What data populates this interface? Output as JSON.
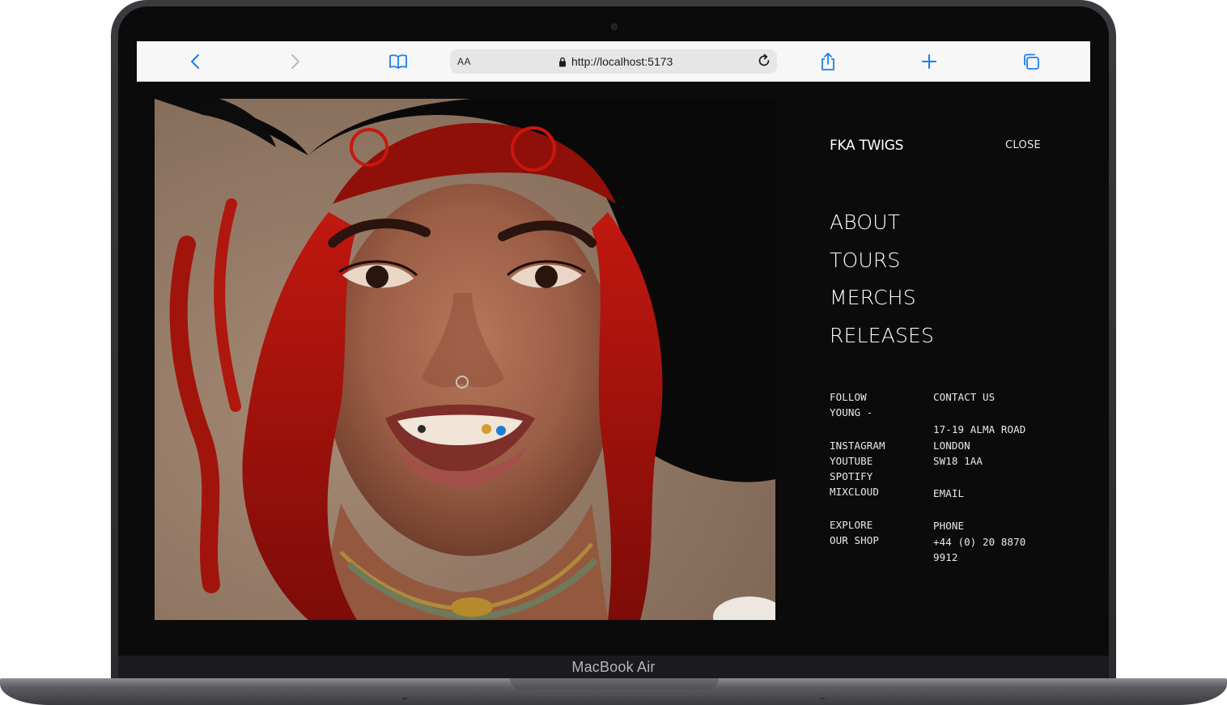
{
  "device": {
    "label": "MacBook Air"
  },
  "browser": {
    "reader_label": "AA",
    "url": "http://localhost:5173"
  },
  "site": {
    "logo": "FKA TWIGS",
    "close_label": "CLOSE",
    "nav": [
      "ABOUT",
      "TOURS",
      "MERCHS",
      "RELEASES"
    ],
    "follow": {
      "line1": "FOLLOW",
      "line2": "YOUNG -"
    },
    "socials": [
      "INSTAGRAM",
      "YOUTUBE",
      "SPOTIFY",
      "MIXCLOUD"
    ],
    "shop": {
      "line1": "EXPLORE",
      "line2": "OUR SHOP"
    },
    "contact": {
      "heading": "CONTACT US",
      "address": [
        "17-19 ALMA ROAD",
        "LONDON",
        "SW18 1AA"
      ],
      "email_label": "EMAIL",
      "phone_label": "PHONE",
      "phone_lines": [
        "+44 (0) 20 8870",
        "9912"
      ]
    }
  },
  "colors": {
    "page_bg": "#0b0b0b",
    "toolbar_bg": "#f7f7f8",
    "toolbar_accent": "#1a7cf0",
    "text": "#ffffff"
  }
}
